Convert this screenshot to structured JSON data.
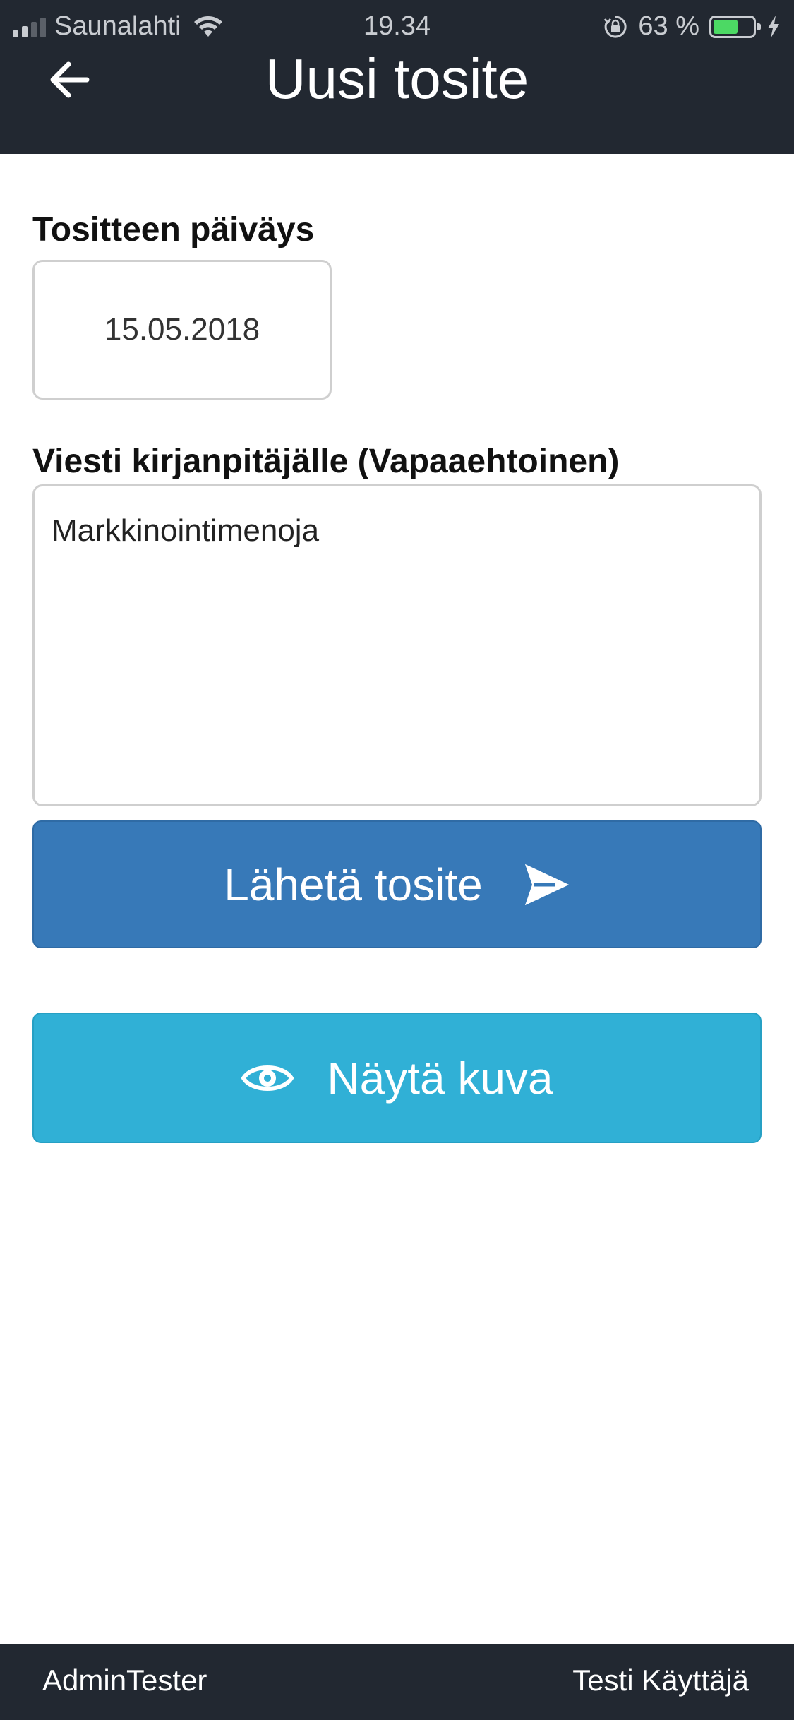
{
  "status_bar": {
    "carrier": "Saunalahti",
    "time": "19.34",
    "battery_text": "63 %",
    "battery_level": 0.63,
    "battery_color": "#4cd964"
  },
  "header": {
    "back_icon": "arrow-left-icon",
    "title": "Uusi tosite",
    "background": "#222831"
  },
  "form": {
    "date_label": "Tositteen päiväys",
    "date_value": "15.05.2018",
    "message_label": "Viesti kirjanpitäjälle (Vapaaehtoinen)",
    "message_value": "Markkinointimenoja"
  },
  "buttons": {
    "send_label": "Lähetä tosite",
    "send_icon": "send-icon",
    "send_color": "#3779b8",
    "view_label": "Näytä kuva",
    "view_icon": "eye-icon",
    "view_color": "#30b0d6"
  },
  "footer": {
    "left_text": "AdminTester",
    "right_text": "Testi Käyttäjä"
  }
}
